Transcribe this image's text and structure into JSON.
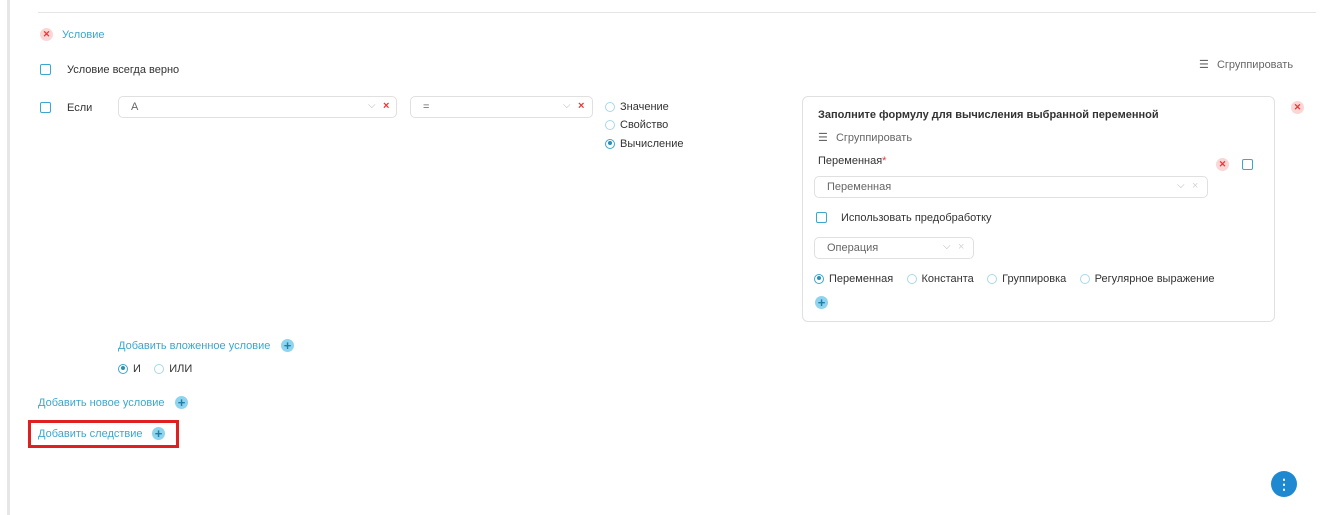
{
  "condition": {
    "remove_icon": "x-circle-icon",
    "title": "Условие",
    "always_true_label": "Условие всегда верно",
    "group_label": "Сгруппировать",
    "group_icon": "indent-icon"
  },
  "if_row": {
    "label": "Если",
    "left_select_value": "А",
    "operator_value": "=",
    "value_types": [
      {
        "label": "Значение",
        "selected": false
      },
      {
        "label": "Свойство",
        "selected": false
      },
      {
        "label": "Вычисление",
        "selected": true
      }
    ]
  },
  "formula_panel": {
    "title": "Заполните формулу для вычисления выбранной переменной",
    "group_label": "Сгруппировать",
    "variable_label": "Переменная",
    "required_mark": "*",
    "variable_placeholder": "Переменная",
    "preprocess_label": "Использовать предобработку",
    "operation_placeholder": "Операция",
    "modes": [
      {
        "label": "Переменная",
        "selected": true
      },
      {
        "label": "Константа",
        "selected": false
      },
      {
        "label": "Группировка",
        "selected": false
      },
      {
        "label": "Регулярное выражение",
        "selected": false
      }
    ]
  },
  "nested": {
    "add_nested_label": "Добавить вложенное условие",
    "logic": [
      {
        "label": "И",
        "selected": true
      },
      {
        "label": "ИЛИ",
        "selected": false
      }
    ]
  },
  "actions": {
    "add_condition_label": "Добавить новое условие",
    "add_consequence_label": "Добавить следствие"
  },
  "colors": {
    "accent": "#3ba7cc",
    "remove": "#e53935",
    "highlight": "#e02020",
    "fab": "#1e88d0"
  }
}
